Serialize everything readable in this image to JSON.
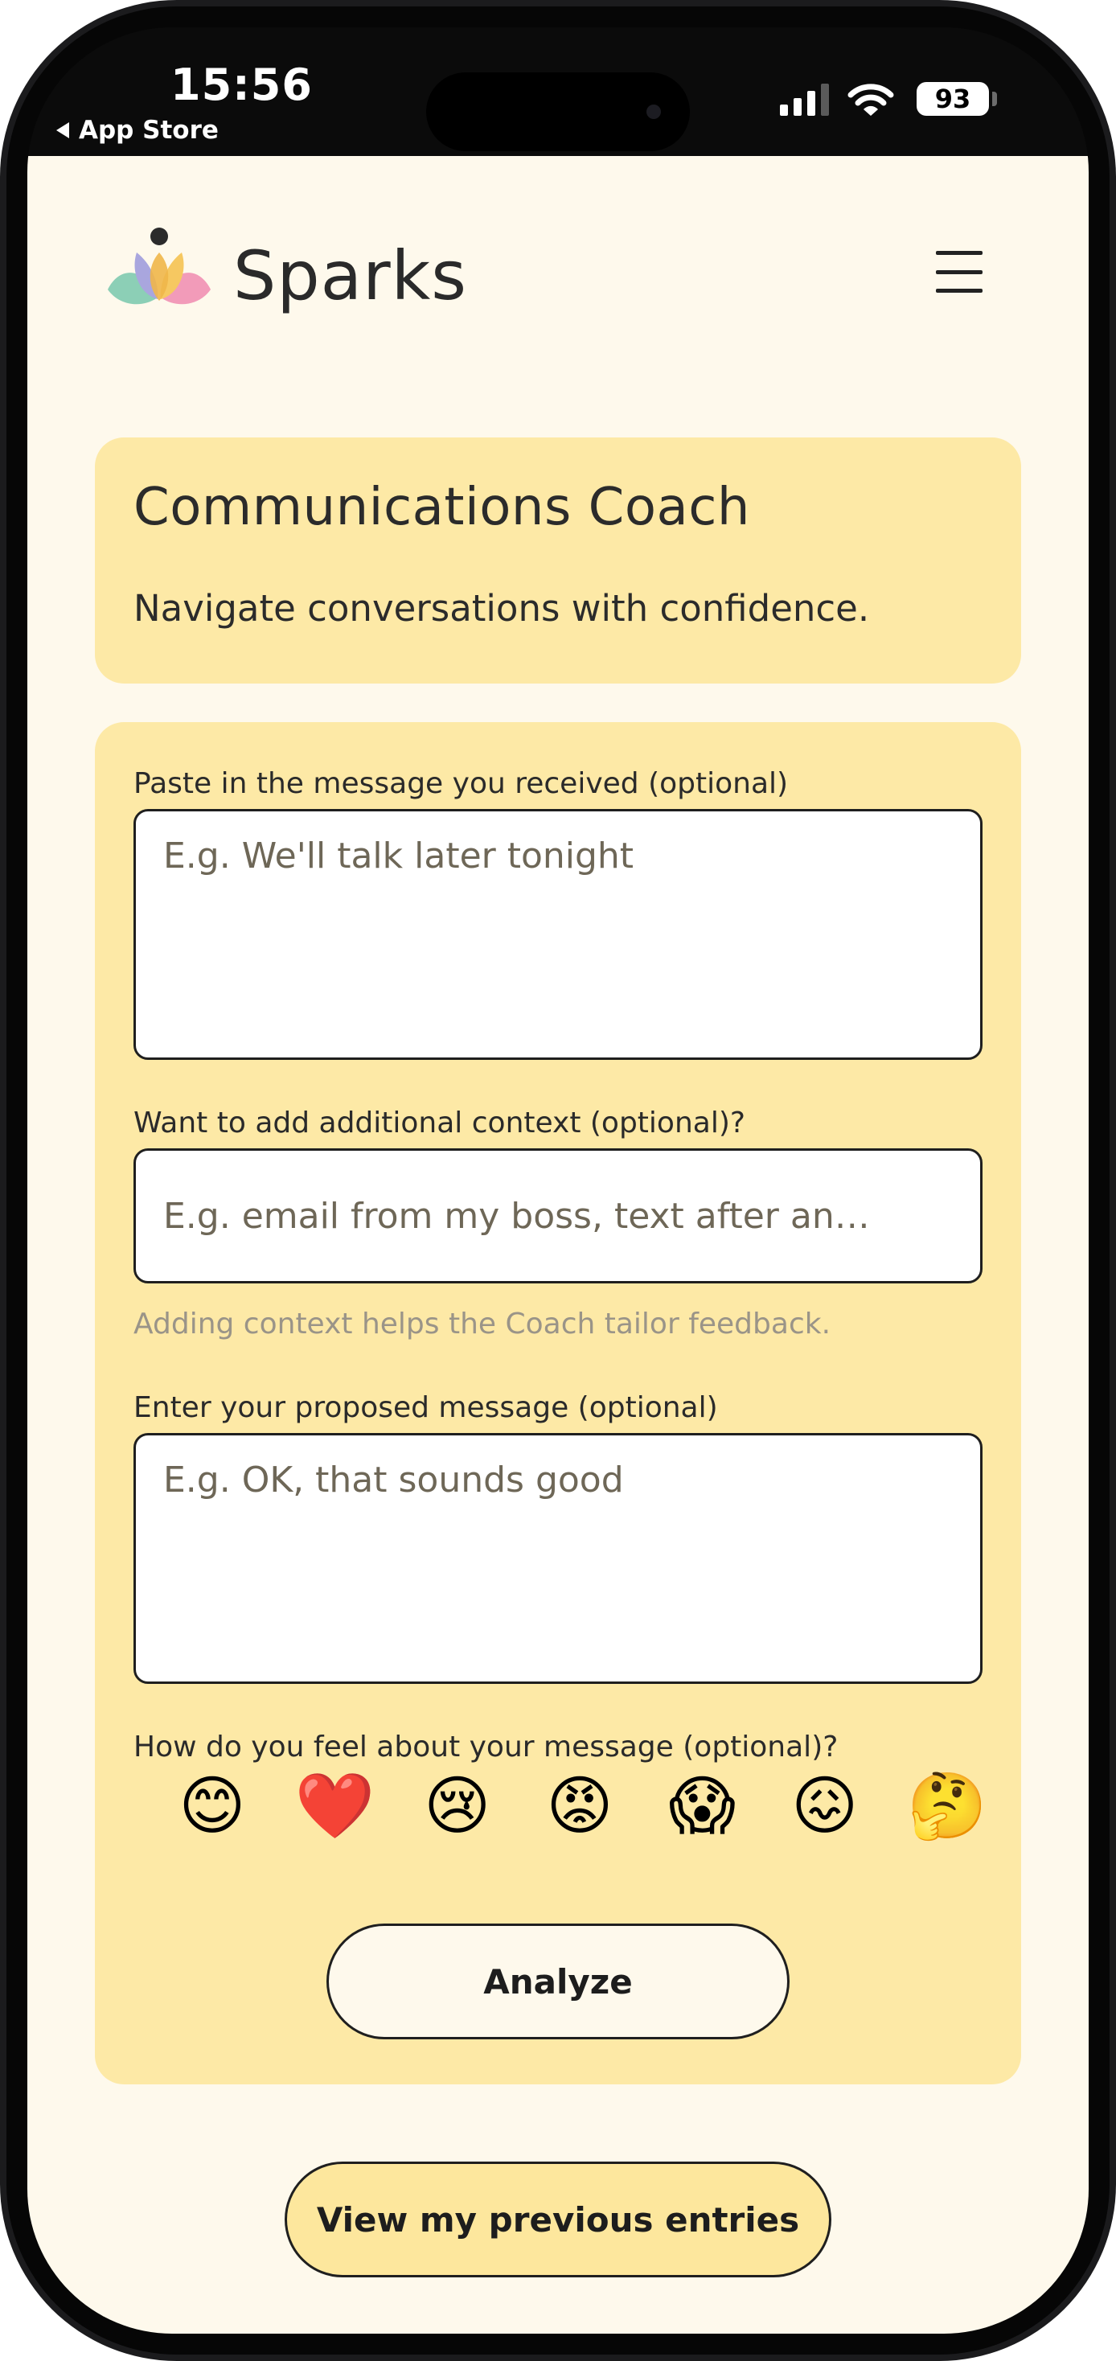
{
  "status_bar": {
    "time": "15:56",
    "back_app": "App Store",
    "battery": "93",
    "icons": [
      "signal-icon",
      "wifi-icon",
      "battery-icon"
    ]
  },
  "header": {
    "brand": "Sparks",
    "logo_icon": "lotus-icon",
    "menu_icon": "hamburger-menu-icon"
  },
  "hero": {
    "title": "Communications Coach",
    "subtitle": "Navigate conversations with confidence."
  },
  "form": {
    "received_label": "Paste in the message you received (optional)",
    "received_placeholder": "E.g. We'll talk later tonight",
    "context_label": "Want to add additional context (optional)?",
    "context_placeholder": "E.g. email from my boss, text after an…",
    "context_hint": "Adding context helps the Coach tailor feedback.",
    "proposed_label": "Enter your proposed message (optional)",
    "proposed_placeholder": "E.g. OK, that sounds good",
    "feeling_label": "How do you feel about your message (optional)?",
    "feelings": [
      {
        "emoji": "😊",
        "icon": "smiling-face-icon"
      },
      {
        "emoji": "❤️",
        "icon": "red-heart-icon"
      },
      {
        "emoji": "😢",
        "icon": "crying-face-icon"
      },
      {
        "emoji": "😡",
        "icon": "angry-face-icon"
      },
      {
        "emoji": "😱",
        "icon": "screaming-face-icon"
      },
      {
        "emoji": "😖",
        "icon": "confounded-face-icon"
      },
      {
        "emoji": "🤔",
        "icon": "thinking-face-icon"
      }
    ],
    "analyze_label": "Analyze"
  },
  "footer": {
    "previous_label": "View my previous entries"
  },
  "colors": {
    "page_bg": "#fef9ec",
    "card_bg": "#fde9a6",
    "secondary_button_bg": "#fde79d",
    "text": "#2a2a2a",
    "hint_text": "#9a9488"
  }
}
